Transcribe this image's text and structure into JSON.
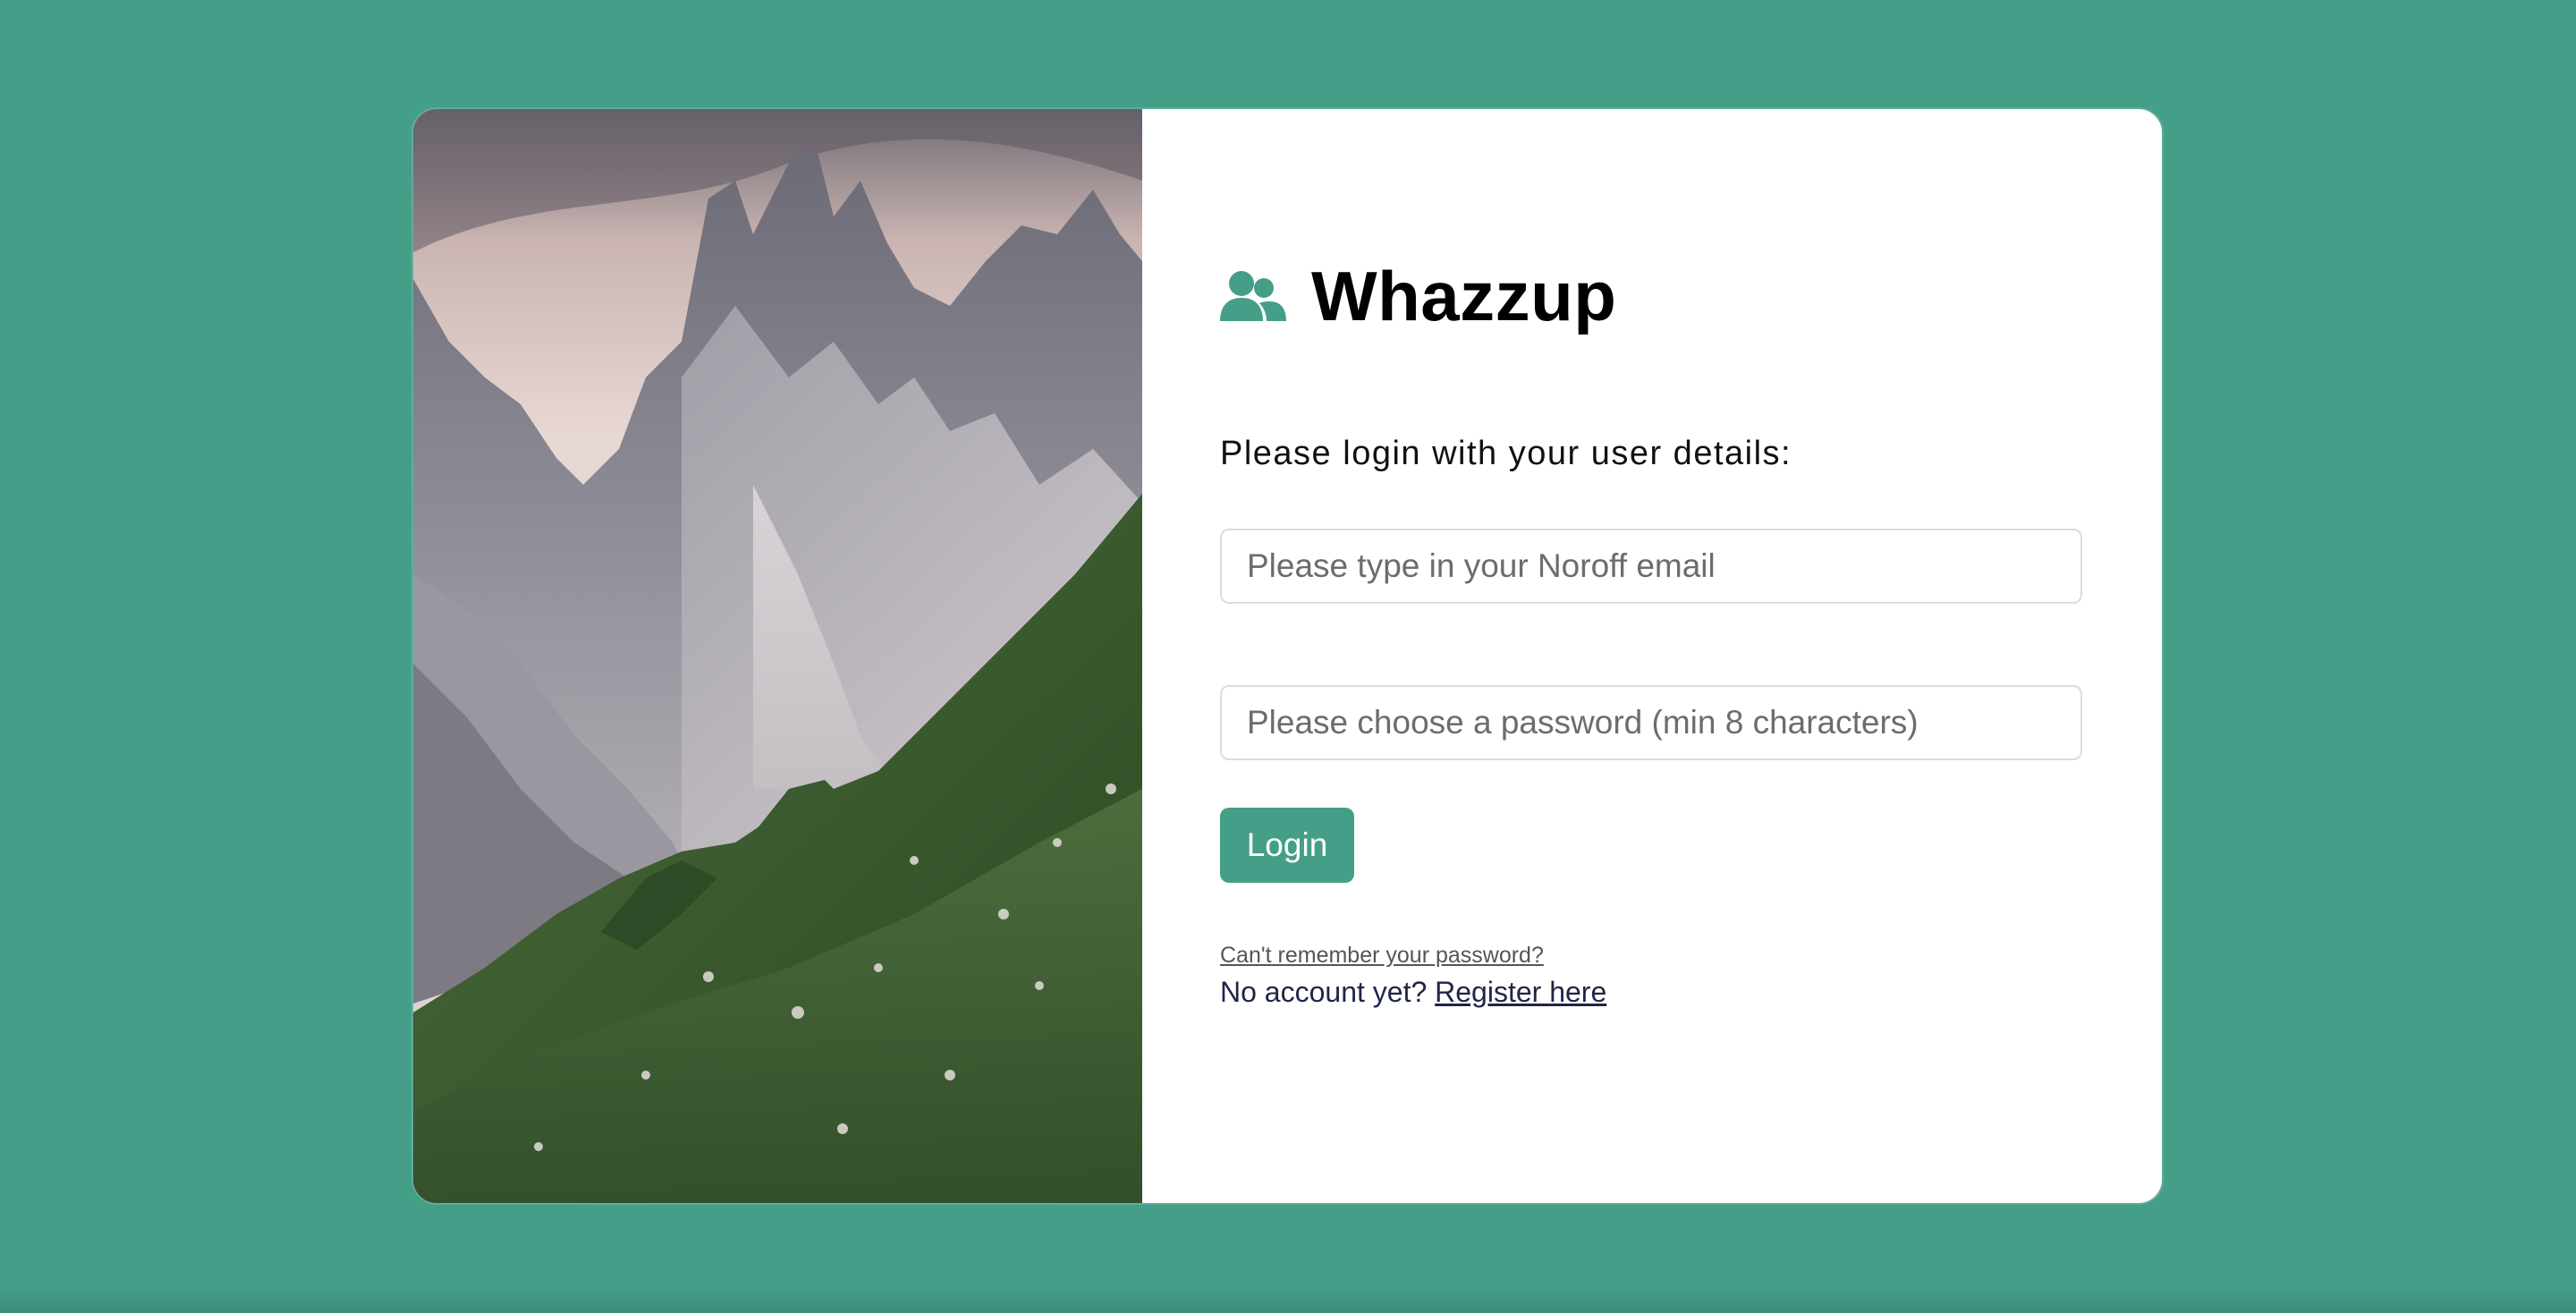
{
  "brand": {
    "icon": "users-icon",
    "title": "Whazzup"
  },
  "login": {
    "instructions": "Please login with your user details:",
    "email_placeholder": "Please type in your Noroff email",
    "password_placeholder": "Please choose a password (min 8 characters)",
    "button_label": "Login",
    "forgot_link": "Can't remember your password?",
    "no_account_text": "No account yet?",
    "register_link": "Register here"
  },
  "colors": {
    "accent": "#459f88",
    "link": "#1f2547"
  }
}
